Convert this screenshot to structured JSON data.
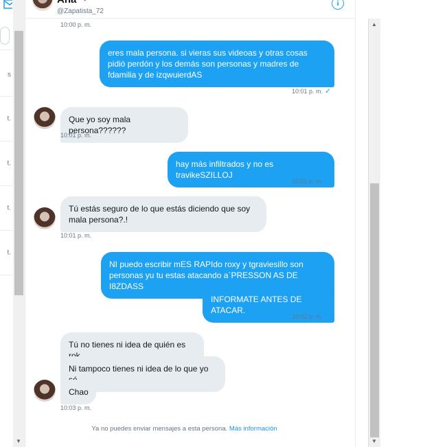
{
  "sidebar": {
    "rows": [
      "s",
      "t.",
      "t.",
      "t.",
      "t."
    ]
  },
  "header": {
    "name": "Ana",
    "heart": "♥",
    "handle": "@Zapatista_72",
    "info_icon": "info-icon"
  },
  "conversation": {
    "top_timestamp": "10:00 p. m.",
    "messages": [
      {
        "id": "m1",
        "direction": "sent",
        "text": "eres mala persona. si vieras sus videoas y otras cosas pidió perdón y los demás son personas y madres de fdamilia y de izqwuierdAS",
        "timestamp": "10:01 p. m."
      },
      {
        "id": "m2",
        "direction": "received",
        "text": "Que yo soy mala persona??????",
        "timestamp": "10:01 p. m."
      },
      {
        "id": "m3",
        "direction": "sent",
        "text": "hay más infiltrados y no es travikeSZILLOJ",
        "timestamp": "10:01 p. m."
      },
      {
        "id": "m4",
        "direction": "received",
        "text": "Tú estás seguro de lo que estás diciendo que soy mala persona?.!",
        "timestamp": "10:01 p. m."
      },
      {
        "id": "m5",
        "direction": "sent",
        "text": "NI puedo escribir mES RAPIdo roxy y tgraviesillo son personas yu tu estas atacando a`PRESSON AS DE I8ZDASS",
        "timestamp": ""
      },
      {
        "id": "m6",
        "direction": "sent",
        "text": "INFORMATE ANTES DE ATACAR.",
        "timestamp": "10:02 p. m."
      },
      {
        "id": "m7",
        "direction": "received",
        "text": "Tú no tienes ni idea de quién es rok",
        "timestamp": ""
      },
      {
        "id": "m8",
        "direction": "received",
        "text": "Ni tampoco tienes ni idea de lo que yo sé",
        "timestamp": ""
      },
      {
        "id": "m9",
        "direction": "received",
        "text": "Chao",
        "timestamp": "10:03 p. m."
      }
    ],
    "read_check": "✓",
    "notice": "Ya no puedes enviar mensajes a esta persona.",
    "notice_link": "Más información"
  },
  "colors": {
    "sent_bubble": "#1da1f2",
    "received_bubble": "#e6ecf0",
    "accent": "#1da1f2"
  }
}
